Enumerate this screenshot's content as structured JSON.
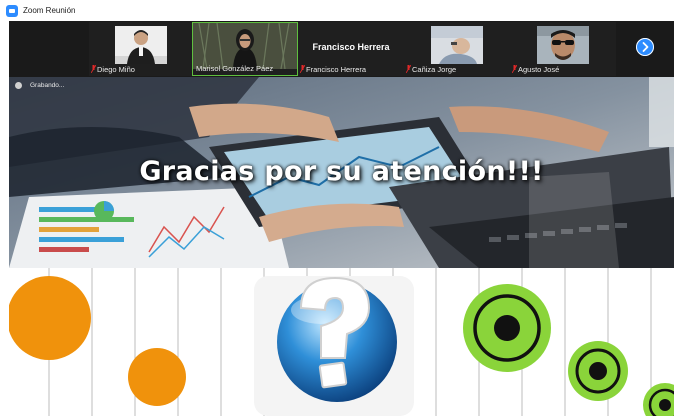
{
  "window": {
    "title": "Zoom Reunión"
  },
  "participants": [
    {
      "name": "Diego Miño"
    },
    {
      "name": "Marisol González Páez"
    },
    {
      "name": "Francisco Herrera",
      "display": "Francisco Herrera"
    },
    {
      "name": "Cañiza Jorge"
    },
    {
      "name": "Agusto José"
    }
  ],
  "recording": {
    "label": "Grabando..."
  },
  "slide": {
    "headline": "Gracias por su atención!!!"
  },
  "colors": {
    "zoom_blue": "#2d8cff",
    "active_border": "#5fbf3f",
    "orange": "#f0920c",
    "green": "#7ed321",
    "muted_red": "#e02828"
  }
}
